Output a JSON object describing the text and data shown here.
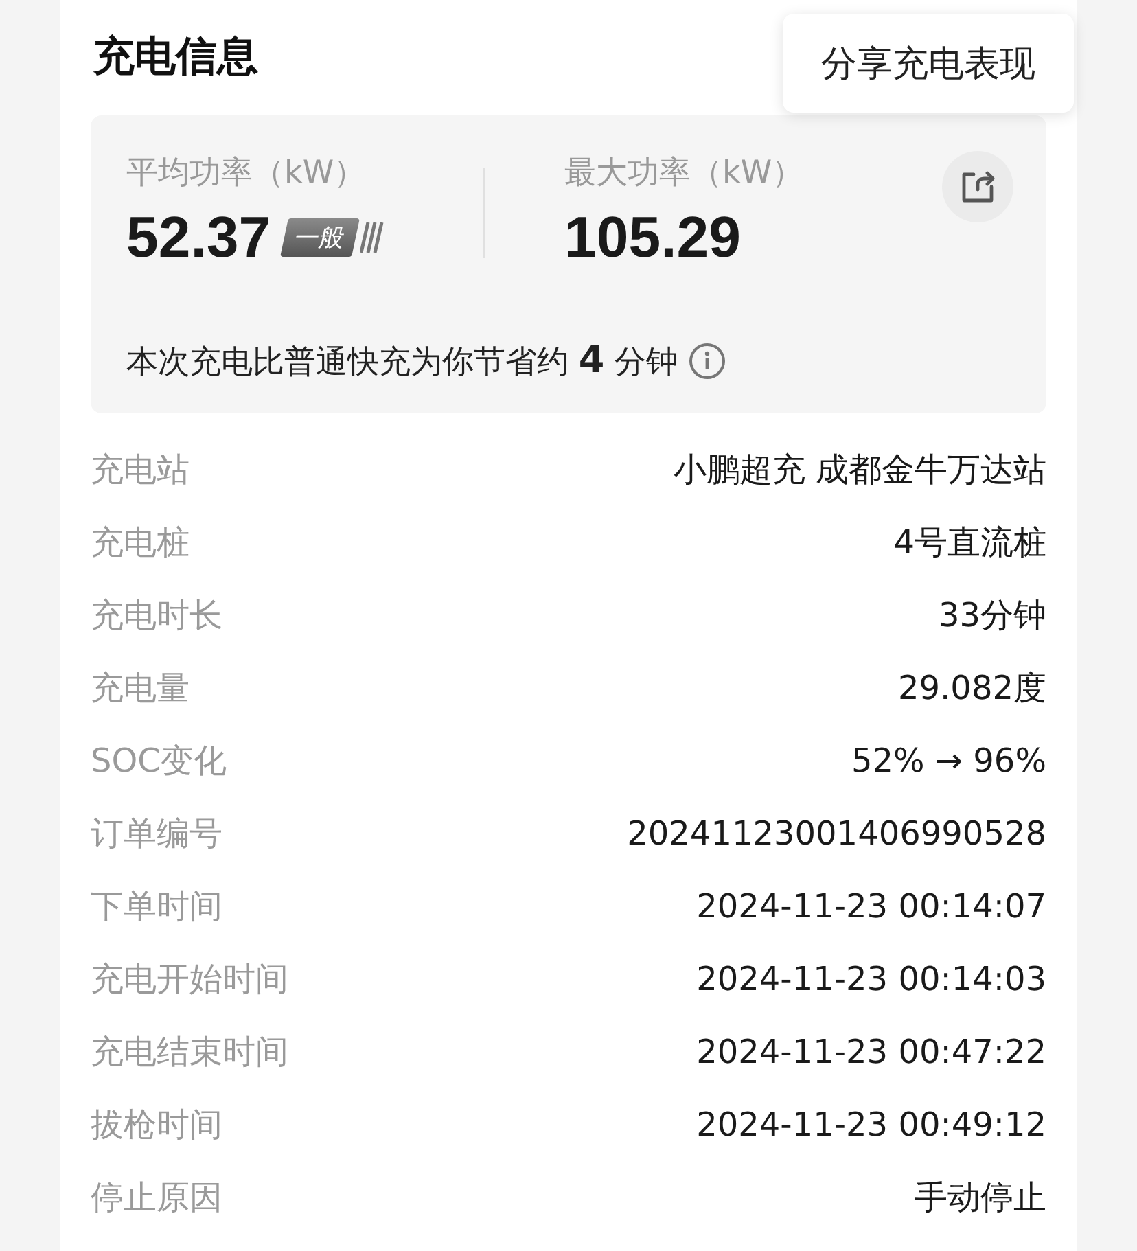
{
  "title": "充电信息",
  "tooltip": {
    "text": "分享充电表现"
  },
  "stats": [
    {
      "label": "平均功率（kW）",
      "value": "52.37",
      "badge": "一般"
    },
    {
      "label": "最大功率（kW）",
      "value": "105.29"
    }
  ],
  "savings": "本次充电比普通快充为你节省约 **4** 分钟",
  "details": [
    {
      "label": "充电站",
      "value": "小鹏超充 成都金牛万达站"
    },
    {
      "label": "充电桩",
      "value": "4号直流桩"
    },
    {
      "label": "充电时长",
      "value": "33分钟"
    },
    {
      "label": "充电量",
      "value": "29.082度"
    },
    {
      "label": "SOC变化",
      "value": "52% → 96%"
    },
    {
      "label": "订单编号",
      "value": "20241123001406990528"
    },
    {
      "label": "下单时间",
      "value": "2024-11-23 00:14:07"
    },
    {
      "label": "充电开始时间",
      "value": "2024-11-23 00:14:03"
    },
    {
      "label": "充电结束时间",
      "value": "2024-11-23 00:47:22"
    },
    {
      "label": "拔枪时间",
      "value": "2024-11-23 00:49:12"
    },
    {
      "label": "停止原因",
      "value": "手动停止"
    }
  ]
}
